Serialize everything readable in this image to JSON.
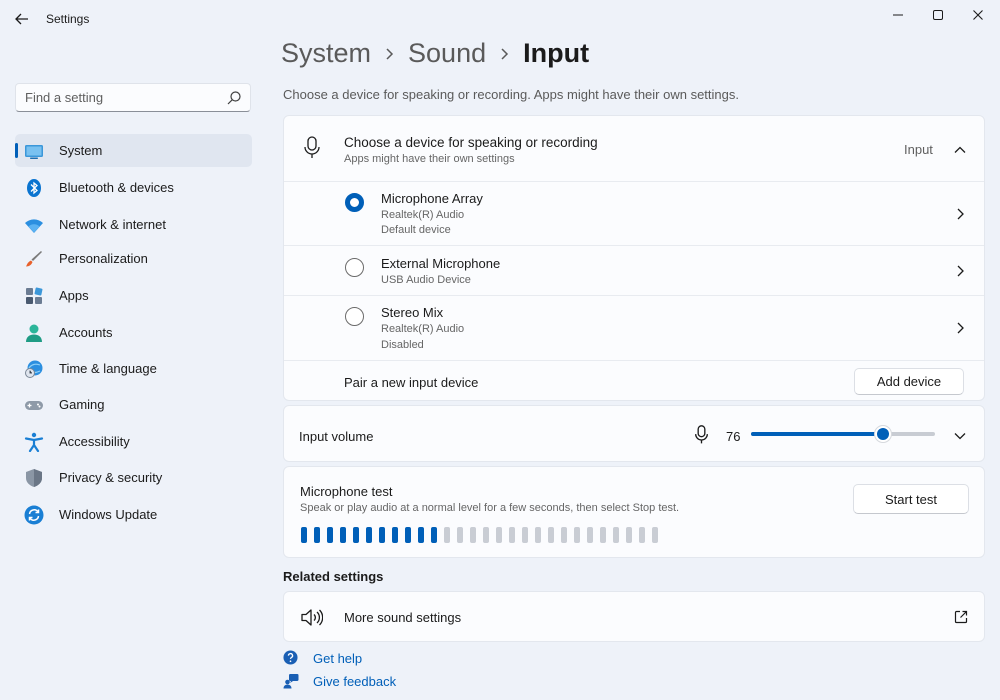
{
  "window": {
    "title": "Settings",
    "controls": [
      "minimize",
      "maximize",
      "close"
    ]
  },
  "search": {
    "placeholder": "Find a setting",
    "value": ""
  },
  "sidebar": {
    "items": [
      {
        "label": "System",
        "icon": "system-icon",
        "active": true
      },
      {
        "label": "Bluetooth & devices",
        "icon": "bluetooth-icon"
      },
      {
        "label": "Network & internet",
        "icon": "wifi-icon"
      },
      {
        "label": "Personalization",
        "icon": "brush-icon"
      },
      {
        "label": "Apps",
        "icon": "apps-icon"
      },
      {
        "label": "Accounts",
        "icon": "account-icon"
      },
      {
        "label": "Time & language",
        "icon": "time-language-icon"
      },
      {
        "label": "Gaming",
        "icon": "gamepad-icon"
      },
      {
        "label": "Accessibility",
        "icon": "accessibility-icon"
      },
      {
        "label": "Privacy & security",
        "icon": "shield-icon"
      },
      {
        "label": "Windows Update",
        "icon": "update-icon"
      }
    ]
  },
  "breadcrumb": {
    "items": [
      "System",
      "Sound"
    ],
    "current": "Input"
  },
  "subtitle": "Choose a device for speaking or recording. Apps might have their own settings.",
  "device_card": {
    "title": "Choose a device for speaking or recording",
    "subtitle": "Apps might have their own settings",
    "section_label": "Input",
    "devices": [
      {
        "name": "Microphone Array",
        "line1": "Realtek(R) Audio",
        "line2": "Default device",
        "selected": true
      },
      {
        "name": "External Microphone",
        "line1": "USB Audio Device",
        "selected": false
      },
      {
        "name": "Stereo Mix",
        "line1": "Realtek(R) Audio",
        "line2": "Disabled",
        "selected": false
      }
    ],
    "pair_label": "Pair a new input device",
    "add_button": "Add device"
  },
  "volume": {
    "label": "Input volume",
    "value": "76",
    "level": 0.76
  },
  "mic_test": {
    "title": "Microphone test",
    "description": "Speak or play audio at a normal level for a few seconds, then select Stop test.",
    "button": "Start test",
    "bars_total": 28,
    "bars_active": 11
  },
  "related": {
    "heading": "Related settings",
    "more_sound": "More sound settings"
  },
  "links": {
    "help": "Get help",
    "feedback": "Give feedback"
  },
  "colors": {
    "accent": "#005fb8",
    "meter_inactive": "#c9cdd4",
    "background": "#eef2f9"
  }
}
